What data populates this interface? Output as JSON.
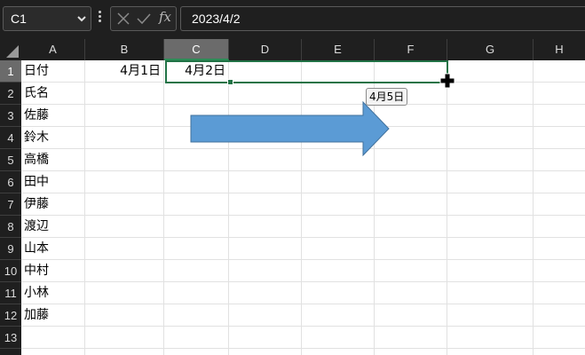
{
  "namebox": {
    "value": "C1"
  },
  "formula": {
    "value": "2023/4/2",
    "fx_label": "fx"
  },
  "columns": [
    "A",
    "B",
    "C",
    "D",
    "E",
    "F",
    "G",
    "H"
  ],
  "rows": [
    "1",
    "2",
    "3",
    "4",
    "5",
    "6",
    "7",
    "8",
    "9",
    "10",
    "11",
    "12",
    "13"
  ],
  "cells": {
    "A1": "日付",
    "B1": "4月1日",
    "C1": "4月2日",
    "A2": "氏名",
    "A3": "佐藤",
    "A4": "鈴木",
    "A5": "高橋",
    "A6": "田中",
    "A7": "伊藤",
    "A8": "渡辺",
    "A9": "山本",
    "A10": "中村",
    "A11": "小林",
    "A12": "加藤"
  },
  "fill_tooltip": "4月5日",
  "colors": {
    "selection_border": "#217346",
    "arrow_fill": "#5b9bd5",
    "header_bg": "#1f1f1f"
  },
  "icons": [
    "chevron-down-icon",
    "more-dots-icon",
    "cancel-icon",
    "enter-check-icon",
    "insert-function-icon",
    "select-all-icon",
    "fill-cross-cursor-icon"
  ]
}
